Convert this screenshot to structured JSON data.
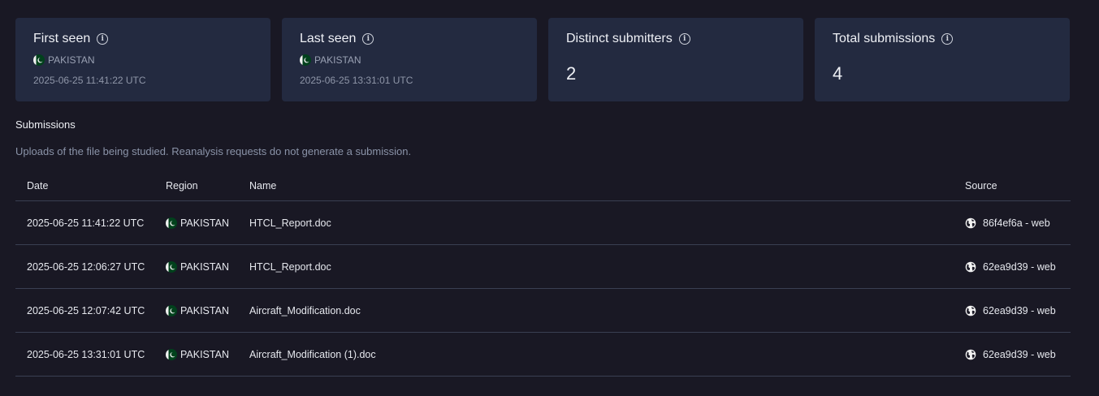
{
  "cards": [
    {
      "title": "First seen",
      "region": "PAKISTAN",
      "date": "2025-06-25 11:41:22 UTC"
    },
    {
      "title": "Last seen",
      "region": "PAKISTAN",
      "date": "2025-06-25 13:31:01 UTC"
    },
    {
      "title": "Distinct submitters",
      "value": "2"
    },
    {
      "title": "Total submissions",
      "value": "4"
    }
  ],
  "submissions": {
    "title": "Submissions",
    "description": "Uploads of the file being studied. Reanalysis requests do not generate a submission.",
    "columns": {
      "date": "Date",
      "region": "Region",
      "name": "Name",
      "source": "Source"
    },
    "rows": [
      {
        "date": "2025-06-25 11:41:22 UTC",
        "region": "PAKISTAN",
        "name": "HTCL_Report.doc",
        "source": "86f4ef6a - web"
      },
      {
        "date": "2025-06-25 12:06:27 UTC",
        "region": "PAKISTAN",
        "name": "HTCL_Report.doc",
        "source": "62ea9d39 - web"
      },
      {
        "date": "2025-06-25 12:07:42 UTC",
        "region": "PAKISTAN",
        "name": "Aircraft_Modification.doc",
        "source": "62ea9d39 - web"
      },
      {
        "date": "2025-06-25 13:31:01 UTC",
        "region": "PAKISTAN",
        "name": "Aircraft_Modification (1).doc",
        "source": "62ea9d39 - web"
      }
    ]
  },
  "icons": {
    "info": "info-icon",
    "flag": "pakistan-flag-icon",
    "source": "globe-icon"
  },
  "colors": {
    "background": "#191824",
    "card": "#232a40",
    "muted": "#8a93a8",
    "divider": "#3a3f52"
  }
}
